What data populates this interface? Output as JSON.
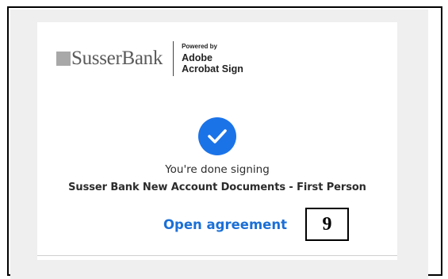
{
  "brand": {
    "bank_name": "SusserBank",
    "powered_by": "Powered by",
    "adobe": "Adobe",
    "acrobat_sign": "Acrobat Sign"
  },
  "status": {
    "icon": "checkmark-icon",
    "message": "You're done signing"
  },
  "agreement": {
    "title": "Susser Bank New Account Documents - First Person",
    "open_link": "Open agreement"
  },
  "annotation": {
    "step_number": "9"
  },
  "colors": {
    "accent": "#1b73e8",
    "link": "#1b6fd6",
    "background_band": "#efefef"
  }
}
